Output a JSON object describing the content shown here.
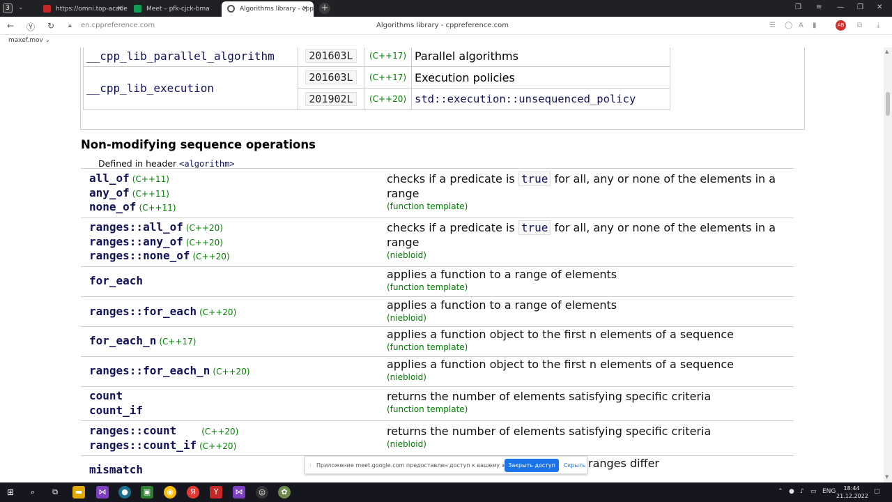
{
  "browser": {
    "tab_count": "3",
    "tabs": [
      {
        "title": "https://omni.top-acade",
        "active": false
      },
      {
        "title": "Meet – pfk-cjck-bma",
        "active": false
      },
      {
        "title": "Algorithms library - cpp",
        "active": true
      }
    ],
    "url": "en.cppreference.com",
    "page_title": "Algorithms library - cppreference.com",
    "bookmark": "maxef.mov"
  },
  "feature_table": [
    {
      "macro": "__cpp_lib_parallel_algorithm",
      "value": "201603L",
      "std": "(C++17)",
      "desc": "Parallel algorithms"
    },
    {
      "macro": "__cpp_lib_execution",
      "value": "201603L",
      "std": "(C++17)",
      "desc": "Execution policies"
    },
    {
      "macro": "",
      "value": "201902L",
      "std": "(C++20)",
      "desc": "std::execution::unsequenced_policy"
    }
  ],
  "section": {
    "title": "Non-modifying sequence operations",
    "defined_prefix": "Defined in header",
    "header": "<algorithm>"
  },
  "ops": [
    {
      "names": [
        {
          "name": "all_of",
          "std": "(C++11)"
        },
        {
          "name": "any_of",
          "std": "(C++11)"
        },
        {
          "name": "none_of",
          "std": "(C++11)"
        }
      ],
      "desc_pre": "checks if a predicate is",
      "desc_code": "true",
      "desc_post": "for all, any or none of the elements in a range",
      "kind": "(function template)"
    },
    {
      "names": [
        {
          "name": "ranges::all_of",
          "std": "(C++20)"
        },
        {
          "name": "ranges::any_of",
          "std": "(C++20)"
        },
        {
          "name": "ranges::none_of",
          "std": "(C++20)"
        }
      ],
      "desc_pre": "checks if a predicate is",
      "desc_code": "true",
      "desc_post": "for all, any or none of the elements in a range",
      "kind": "(niebloid)"
    },
    {
      "names": [
        {
          "name": "for_each",
          "std": ""
        }
      ],
      "desc": "applies a function to a range of elements",
      "kind": "(function template)"
    },
    {
      "names": [
        {
          "name": "ranges::for_each",
          "std": "(C++20)"
        }
      ],
      "desc": "applies a function to a range of elements",
      "kind": "(niebloid)"
    },
    {
      "names": [
        {
          "name": "for_each_n",
          "std": "(C++17)"
        }
      ],
      "desc": "applies a function object to the first n elements of a sequence",
      "kind": "(function template)"
    },
    {
      "names": [
        {
          "name": "ranges::for_each_n",
          "std": "(C++20)"
        }
      ],
      "desc": "applies a function object to the first n elements of a sequence",
      "kind": "(niebloid)"
    },
    {
      "names": [
        {
          "name": "count",
          "std": ""
        },
        {
          "name": "count_if",
          "std": ""
        }
      ],
      "desc": "returns the number of elements satisfying specific criteria",
      "kind": "(function template)"
    },
    {
      "names": [
        {
          "name": "ranges::count",
          "std": "(C++20)"
        },
        {
          "name": "ranges::count_if",
          "std": "(C++20)"
        }
      ],
      "desc": "returns the number of elements satisfying specific criteria",
      "kind": "(niebloid)"
    },
    {
      "names": [
        {
          "name": "mismatch",
          "std": ""
        }
      ],
      "desc": "ranges differ",
      "kind": ""
    }
  ],
  "share_banner": {
    "message": "Приложение meet.google.com предоставлен доступ к вашему экрану.",
    "stop_label": "Закрыть доступ",
    "hide_label": "Скрыть"
  },
  "taskbar": {
    "lang": "ENG",
    "time": "18:44",
    "date": "21.12.2022"
  }
}
